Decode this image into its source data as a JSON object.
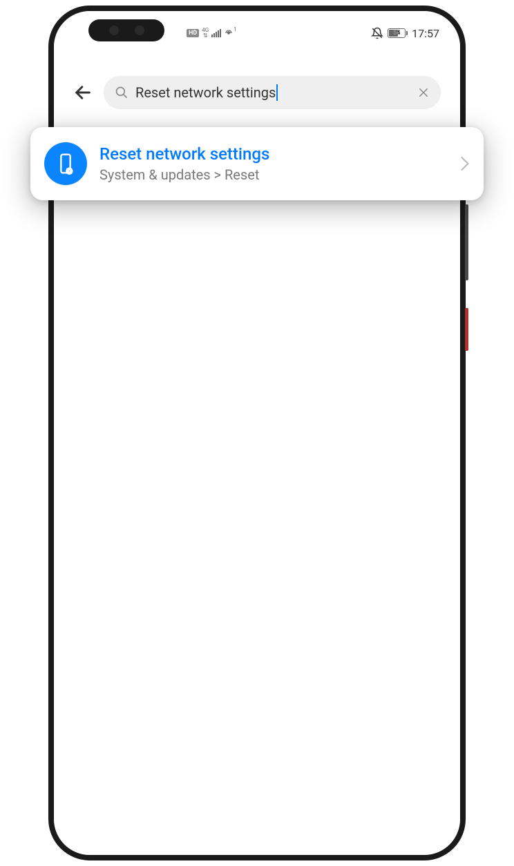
{
  "status": {
    "hd": "HD",
    "network_type": "4G",
    "battery_percent": "54",
    "time": "17:57",
    "hotspot_sup": "1"
  },
  "search": {
    "query": "Reset network settings"
  },
  "result": {
    "title": "Reset network settings",
    "path": "System & updates > Reset"
  }
}
